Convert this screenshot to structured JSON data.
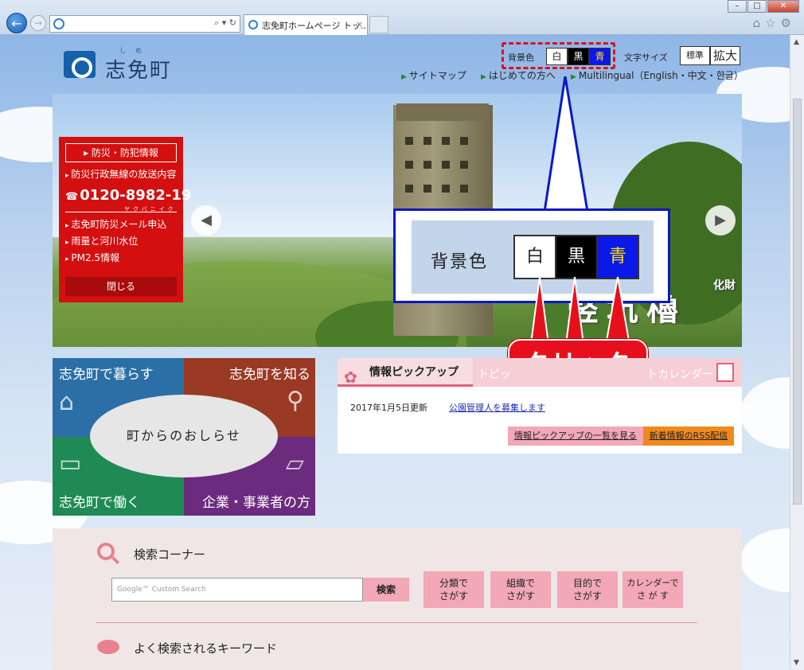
{
  "browser": {
    "tab_title": "志免町ホームページ トッ..."
  },
  "header": {
    "logo_text": "志免町",
    "logo_ruby": "しめ",
    "bg_color_label": "背景色",
    "bg_options": [
      "白",
      "黒",
      "青"
    ],
    "font_size_label": "文字サイズ",
    "font_size_options": [
      "標準",
      "拡大"
    ],
    "links": [
      "サイトマップ",
      "はじめての方へ",
      "Multilingual（English・中文・한글）"
    ]
  },
  "emergency": {
    "header": "防災・防犯情報",
    "items_top": [
      "防災行政無線の放送内容"
    ],
    "tel_ruby": "ヤクバニイク",
    "tel": "0120-8982-19",
    "items_bottom": [
      "志免町防災メール申込",
      "雨量と河川水位",
      "PM2.5情報"
    ],
    "close": "閉じる"
  },
  "hero": {
    "caption_small": "化財",
    "caption": "竪坑櫓"
  },
  "callout": {
    "label": "背景色",
    "options": [
      "白",
      "黒",
      "青"
    ],
    "click": "クリック"
  },
  "tiles": {
    "t1": "志免町で暮らす",
    "t2": "志免町を知る",
    "t3": "志免町で働く",
    "t4": "企業・事業者の方",
    "center": "町からのおしらせ"
  },
  "pickup": {
    "tab_active": "情報ピックアップ",
    "tab2": "トピッ",
    "tab3": "トカレンダー",
    "date": "2017年1月5日更新",
    "news": "公園管理人を募集します",
    "btn_list": "情報ピックアップの一覧を見る",
    "btn_rss": "新着情報のRSS配信"
  },
  "search": {
    "title": "検索コーナー",
    "placeholder": "Google™ Custom Search",
    "button": "検索",
    "cats": [
      {
        "l1": "分類で",
        "l2": "さがす"
      },
      {
        "l1": "組織で",
        "l2": "さがす"
      },
      {
        "l1": "目的で",
        "l2": "さがす"
      },
      {
        "l1": "カレンダーで",
        "l2": "さ が す"
      }
    ],
    "keyword_title": "よく検索されるキーワード"
  },
  "colors": {
    "emergency_red": "#d40f0f",
    "callout_blue": "#0a18c8",
    "click_red": "#e80f1c",
    "tile_blue": "#2b6fa6",
    "tile_brown": "#9a3a24",
    "tile_green": "#1f8a55",
    "tile_purple": "#6b2b7e"
  }
}
